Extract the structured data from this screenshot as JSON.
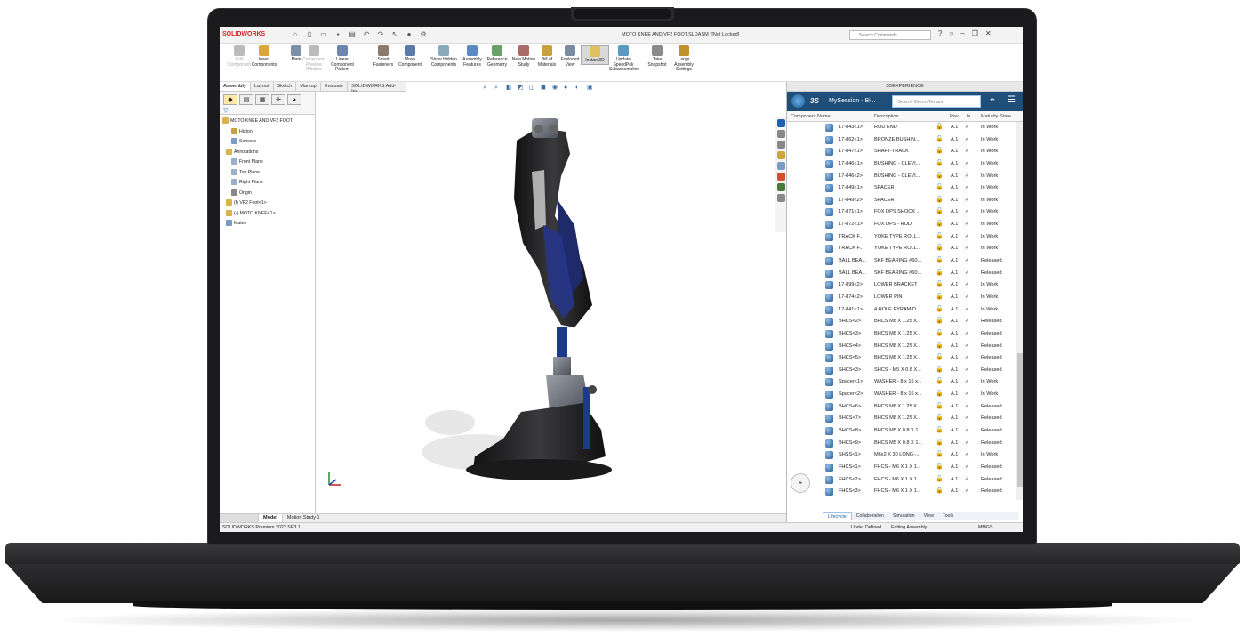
{
  "app": {
    "logo": "SOLIDWORKS",
    "doc_title": "MOTO KNEE AND VF2 FOOT.SLDASM *[Not Locked]",
    "search_placeholder": "Search Commands"
  },
  "ribbon": {
    "buttons": [
      {
        "label": "Edit Component",
        "enabled": false
      },
      {
        "label": "Insert Components",
        "enabled": true
      },
      {
        "label": "Mate",
        "enabled": true
      },
      {
        "label": "Component Preview Window",
        "enabled": false
      },
      {
        "label": "Linear Component Pattern",
        "enabled": true
      },
      {
        "label": "Smart Fasteners",
        "enabled": true
      },
      {
        "label": "Move Component",
        "enabled": true
      },
      {
        "label": "Show Hidden Components",
        "enabled": true
      },
      {
        "label": "Assembly Features",
        "enabled": true
      },
      {
        "label": "Reference Geometry",
        "enabled": true
      },
      {
        "label": "New Motion Study",
        "enabled": true
      },
      {
        "label": "Bill of Materials",
        "enabled": true
      },
      {
        "label": "Exploded View",
        "enabled": true
      },
      {
        "label": "Instant3D",
        "enabled": true,
        "active": true
      },
      {
        "label": "Update SpeedPak Subassemblies",
        "enabled": true
      },
      {
        "label": "Take Snapshot",
        "enabled": true
      },
      {
        "label": "Large Assembly Settings",
        "enabled": true
      }
    ]
  },
  "tabs": [
    "Assembly",
    "Layout",
    "Sketch",
    "Markup",
    "Evaluate",
    "SOLIDWORKS Add-Ins"
  ],
  "feature_tree": {
    "root": "MOTO KNEE AND VF2 FOOT",
    "items": [
      "History",
      "Sensors",
      "Annotations",
      "Front Plane",
      "Top Plane",
      "Right Plane",
      "Origin",
      "(f) VF2 Foot<1>",
      "(-) MOTO KNEE<1>",
      "Mates"
    ]
  },
  "bottom_tabs": [
    "Model",
    "Motion Study 1"
  ],
  "status": {
    "version": "SOLIDWORKS Premium 2022 SP3.1",
    "defined": "Under Defined",
    "mode": "Editing Assembly",
    "units": "MMGS"
  },
  "panel": {
    "title": "3DEXPERIENCE",
    "session": "MySession - Bi...",
    "tenant_placeholder": "Search Demo Tenant",
    "columns": [
      "Component Name",
      "Description",
      "Rev",
      "Is...",
      "Maturity State"
    ],
    "rows": [
      [
        "17-843<1>",
        "ROD END",
        "A.1",
        "In Work"
      ],
      [
        "17-862<1>",
        "BRONZE BUSHIN...",
        "A.1",
        "In Work"
      ],
      [
        "17-847<1>",
        "SHAFT-TRACK",
        "A.1",
        "In Work"
      ],
      [
        "17-846<1>",
        "BUSHING - CLEVI...",
        "A.1",
        "In Work"
      ],
      [
        "17-846<2>",
        "BUSHING - CLEVI...",
        "A.1",
        "In Work"
      ],
      [
        "17-849<1>",
        "SPACER",
        "A.1",
        "In Work"
      ],
      [
        "17-849<2>",
        "SPACER",
        "A.1",
        "In Work"
      ],
      [
        "17-871<1>",
        "FOX DPS SHOCK ...",
        "A.1",
        "In Work"
      ],
      [
        "17-872<1>",
        "FOX DPS - ROD",
        "A.1",
        "In Work"
      ],
      [
        "TRACK F...",
        "YOKE TYPE ROLL...",
        "A.1",
        "In Work"
      ],
      [
        "TRACK F...",
        "YOKE TYPE ROLL...",
        "A.1",
        "In Work"
      ],
      [
        "BALL BEA...",
        "SKF BEARING #60...",
        "A.1",
        "Released"
      ],
      [
        "BALL BEA...",
        "SKF BEARING #60...",
        "A.1",
        "Released"
      ],
      [
        "17-899<2>",
        "LOWER BRACKET",
        "A.1",
        "In Work"
      ],
      [
        "17-874<2>",
        "LOWER PIN",
        "A.1",
        "In Work"
      ],
      [
        "17-841<1>",
        "4 HOLE PYRAMID",
        "A.1",
        "In Work"
      ],
      [
        "BHCS<2>",
        "BHCS M8 X 1.25 X...",
        "A.1",
        "Released"
      ],
      [
        "BHCS<3>",
        "BHCS M8 X 1.25 X...",
        "A.1",
        "Released"
      ],
      [
        "BHCS<4>",
        "BHCS M8 X 1.25 X...",
        "A.1",
        "Released"
      ],
      [
        "BHCS<5>",
        "BHCS M8 X 1.25 X...",
        "A.1",
        "Released"
      ],
      [
        "SHCS<3>",
        "SHCS - M5 X 0.8 X...",
        "A.1",
        "Released"
      ],
      [
        "Spacer<1>",
        "WASHER - 8 x 16 x...",
        "A.1",
        "In Work"
      ],
      [
        "Spacer<2>",
        "WASHER - 8 x 16 x...",
        "A.1",
        "In Work"
      ],
      [
        "BHCS<6>",
        "BHCS M8 X 1.25 X...",
        "A.1",
        "Released"
      ],
      [
        "BHCS<7>",
        "BHCS M8 X 1.25 X...",
        "A.1",
        "Released"
      ],
      [
        "BHCS<8>",
        "BHCS M5 X 0.8 X 1...",
        "A.1",
        "Released"
      ],
      [
        "BHCS<9>",
        "BHCS M5 X 0.8 X 1...",
        "A.1",
        "Released"
      ],
      [
        "SHSS<1>",
        "M6x2 X 30 LONG-...",
        "A.1",
        "In Work"
      ],
      [
        "FHCS<1>",
        "FHCS - M6 X 1 X 1...",
        "A.1",
        "Released"
      ],
      [
        "FHCS<2>",
        "FHCS - M6 X 1 X 1...",
        "A.1",
        "Released"
      ],
      [
        "FHCS<3>",
        "FHCS - M6 X 1 X 1...",
        "A.1",
        "Released"
      ]
    ],
    "tabs": [
      "Lifecycle",
      "Collaboration",
      "Simulation",
      "View",
      "Tools"
    ]
  }
}
